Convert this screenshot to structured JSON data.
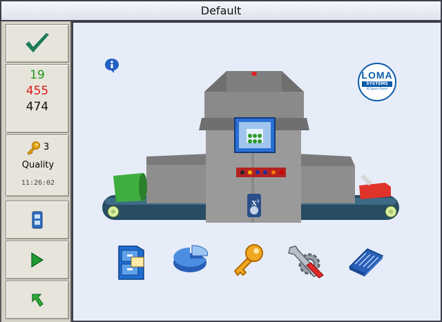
{
  "window": {
    "title": "Default"
  },
  "status": {
    "good_count": "19",
    "reject_count": "455",
    "total_count": "474",
    "access_level": "3",
    "mode": "Quality",
    "time": "11:26:02"
  },
  "brand": {
    "name": "LOMA",
    "subtitle": "SYSTEMS",
    "tagline": "IQ Space Saver"
  },
  "machine": {
    "model_badge": "X",
    "model_badge_sup": "3"
  },
  "colors": {
    "good": "#1b9a1b",
    "reject": "#e01818",
    "total": "#111111",
    "accent": "#0a5aa8"
  },
  "icons": {
    "accept": "checkmark-icon",
    "key": "key-icon",
    "file": "file-cabinet-icon",
    "play": "play-icon",
    "back": "back-arrow-icon",
    "info": "info-icon",
    "tools": [
      "file-cabinet-icon",
      "pie-chart-icon",
      "key-icon",
      "settings-tools-icon",
      "manuals-icon"
    ]
  }
}
